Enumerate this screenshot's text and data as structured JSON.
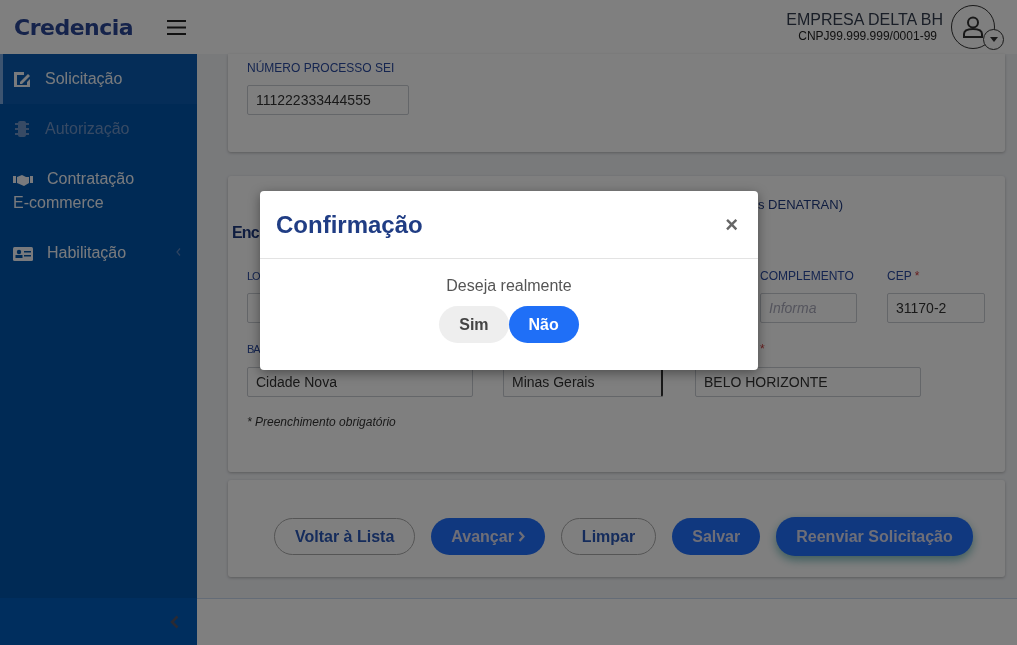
{
  "header": {
    "logo": "Credencia",
    "company": "EMPRESA DELTA BH",
    "cnpj": "CNPJ99.999.999/0001-99"
  },
  "sidebar": {
    "items": [
      {
        "label": "Solicitação",
        "selected": true,
        "disabled": false,
        "expandable": false
      },
      {
        "label": "Autorização",
        "selected": false,
        "disabled": true,
        "expandable": false
      },
      {
        "label": "Contratação E-commerce",
        "selected": false,
        "disabled": false,
        "expandable": false
      },
      {
        "label": "Habilitação",
        "selected": false,
        "disabled": false,
        "expandable": true
      }
    ]
  },
  "process_card": {
    "label": "NÚMERO PROCESSO SEI",
    "value": "111222333444555"
  },
  "address_card": {
    "note_fragment": "s DENATRAN)",
    "heading_fragment": "Enc",
    "row_1": [
      {
        "label": "LO"
      },
      {
        "label": "COMPLEMENTO",
        "placeholder": "Informa"
      },
      {
        "label": "CEP",
        "required": true,
        "value": "31170-2"
      }
    ],
    "row_2": [
      {
        "label": "BA",
        "value": "Cidade Nova"
      },
      {
        "kind": "select",
        "value": "Minas Gerais"
      },
      {
        "label": "*",
        "value": "BELO HORIZONTE"
      }
    ],
    "required_note": "* Preenchimento obrigatório"
  },
  "actions": [
    {
      "label": "Voltar à Lista",
      "kind": "outline",
      "focused": false,
      "chevron": false
    },
    {
      "label": "Avançar",
      "kind": "primary",
      "focused": false,
      "chevron": true
    },
    {
      "label": "Limpar",
      "kind": "outline",
      "focused": false,
      "chevron": false
    },
    {
      "label": "Salvar",
      "kind": "primary",
      "focused": false,
      "chevron": false
    },
    {
      "label": "Reenviar Solicitação",
      "kind": "primary",
      "focused": true,
      "chevron": false
    }
  ],
  "modal": {
    "title": "Confirmação",
    "close": "×",
    "message": "Deseja realmente",
    "buttons": [
      {
        "label": "Sim",
        "kind": "secondary"
      },
      {
        "label": "Não",
        "kind": "primary"
      }
    ]
  }
}
